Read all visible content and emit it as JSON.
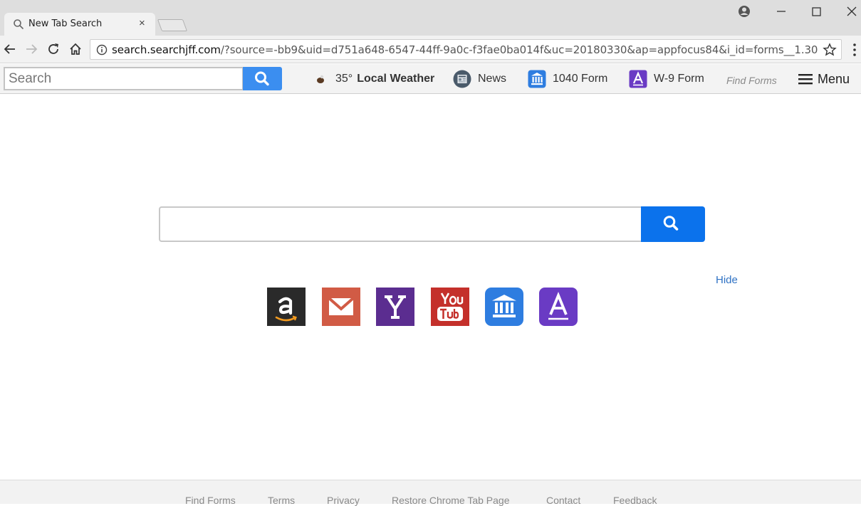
{
  "browser": {
    "tab_title": "New Tab Search",
    "tab_close": "×",
    "url_host": "search.searchjff.com",
    "url_rest": "/?source=-bb9&uid=d751a648-6547-44ff-9a0c-f3fae0ba014f&uc=20180330&ap=appfocus84&i_id=forms__1.30",
    "window_controls": {
      "minimize": "—",
      "maximize": "☐",
      "close": "✕"
    }
  },
  "extension_bar": {
    "search_placeholder": "Search",
    "weather_temp": "35°",
    "weather_label": "Local Weather",
    "news_label": "News",
    "form1040_label": "1040 Form",
    "w9_label": "W-9 Form",
    "find_forms_label": "Find Forms",
    "menu_label": "Menu"
  },
  "main": {
    "search_value": "",
    "hide_label": "Hide",
    "tiles": [
      {
        "name": "amazon-tile",
        "color": "#2a2a2a"
      },
      {
        "name": "gmail-tile",
        "color": "#d15b45"
      },
      {
        "name": "yahoo-tile",
        "color": "#5b2d90"
      },
      {
        "name": "youtube-tile",
        "color": "#c4302b"
      },
      {
        "name": "form-1040-tile",
        "color": "#2e7de0"
      },
      {
        "name": "w9-form-tile",
        "color": "#6a3bc4"
      }
    ]
  },
  "footer": {
    "links": [
      "Find Forms",
      "Terms",
      "Privacy",
      "Restore Chrome Tab Page",
      "Contact",
      "Feedback"
    ]
  },
  "colors": {
    "accent_blue": "#0b72ec",
    "ext_search_button": "#3b8ef0",
    "link_blue": "#2f72c4"
  }
}
